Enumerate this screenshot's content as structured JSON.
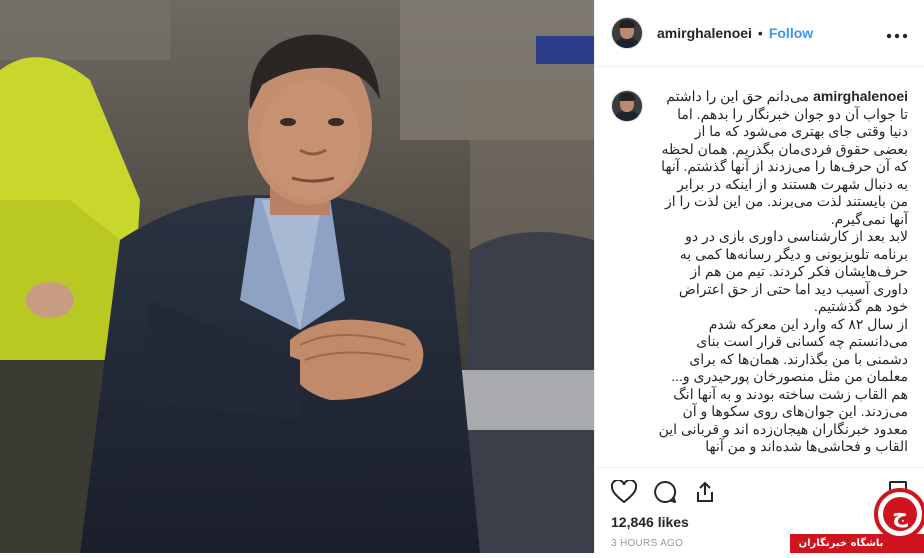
{
  "post": {
    "username": "amirghalenoei",
    "dot": "•",
    "follow_label": "Follow",
    "more_icon": "more-options-icon",
    "caption_username": "amirghalenoei",
    "caption_paragraphs": [
      "می‌دانم حق این را داشتم تا جواب آن دو جوان خبرنگار را بدهم. اما دنیا وقتی جای بهتری می‌شود که ما از بعضی حقوق فردی‌مان بگذریم. همان لحظه که آن حرف‌ها را می‌زدند از آنها گذشتم. آنها به دنبال شهرت هستند و از اینکه در برابر من بایستند لذت می‌برند. من این لذت را از آنها نمی‌گیرم.",
      "لابد بعد از کارشناسی داوری بازی در دو برنامه تلویزیونی و دیگر رسانه‌ها کمی به حرف‌هایشان فکر کردند. تیم من هم از داوری آسیب دید اما حتی از حق اعتراض خود هم گذشتیم.",
      "از سال ۸۲ که وارد این معرکه شدم می‌دانستم چه کسانی قرار است بنای دشمنی با من بگذارند. همان‌ها که برای معلمان من مثل منصورخان پورحیدری و... هم القاب زشت ساخته بودند و به آنها انگ می‌زدند. این جوان‌های روی سکوها و آن معدود خبرنگاران هیجان‌زده اند و قربانی این القاب و فحاشی‌ها شده‌اند و من آنها"
    ],
    "likes": "12,846 likes",
    "time": "3 HOURS AGO",
    "icons": [
      "heart-icon",
      "comment-icon",
      "share-icon",
      "bookmark-icon"
    ]
  },
  "watermark": {
    "text": "باشگاه خبرنگاران"
  },
  "colors": {
    "follow": "#3897f0",
    "text": "#262626",
    "muted": "#999999",
    "border": "#efefef",
    "watermark_red": "#d0141e"
  }
}
